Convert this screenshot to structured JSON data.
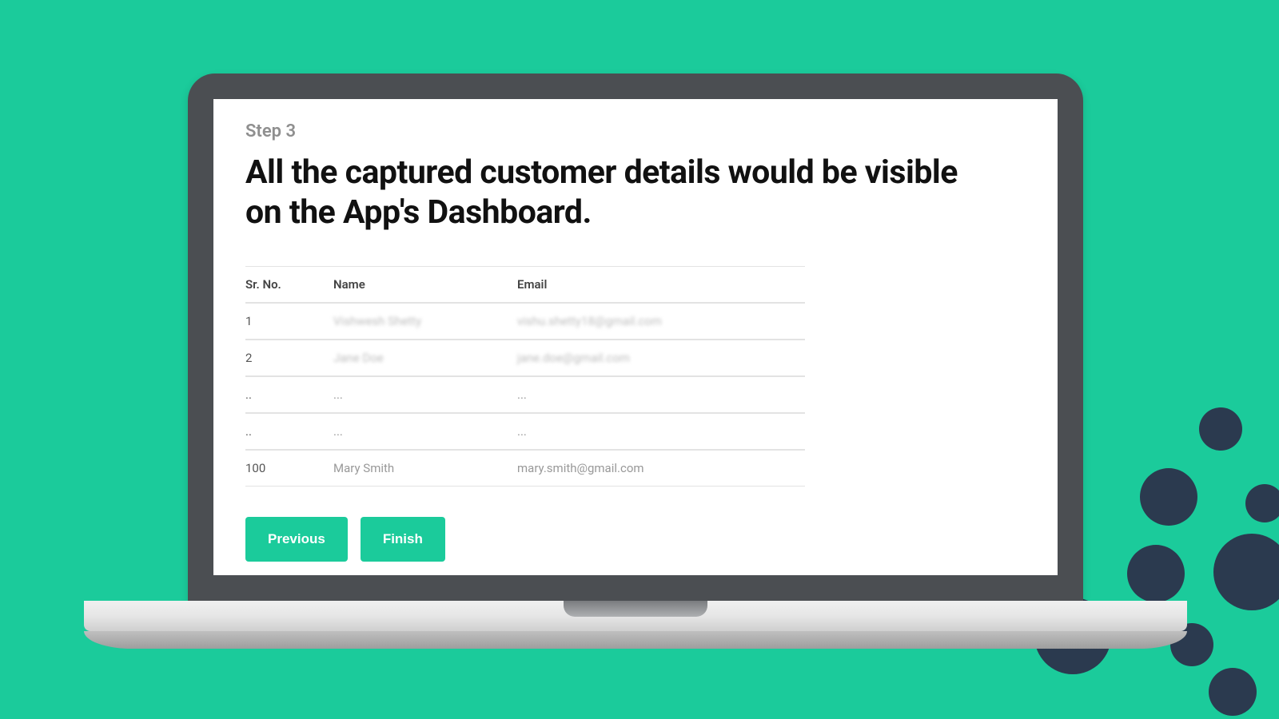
{
  "step_label": "Step 3",
  "heading": "All the captured customer details would be visible on the App's Dashboard.",
  "table": {
    "headers": {
      "srno": "Sr. No.",
      "name": "Name",
      "email": "Email"
    },
    "rows": [
      {
        "srno": "1",
        "name": "Vishwesh Shetty",
        "email": "vishu.shetty18@gmail.com",
        "blurred": true
      },
      {
        "srno": "2",
        "name": "Jane Doe",
        "email": "jane.doe@gmail.com",
        "blurred": true
      },
      {
        "srno": "..",
        "name": "...",
        "email": "...",
        "blurred": false
      },
      {
        "srno": "..",
        "name": "...",
        "email": "...",
        "blurred": false
      },
      {
        "srno": "100",
        "name": "Mary Smith",
        "email": "mary.smith@gmail.com",
        "blurred": false
      }
    ]
  },
  "buttons": {
    "previous": "Previous",
    "finish": "Finish"
  },
  "colors": {
    "accent": "#1bcb9b",
    "dots": "#2b3a4f"
  }
}
